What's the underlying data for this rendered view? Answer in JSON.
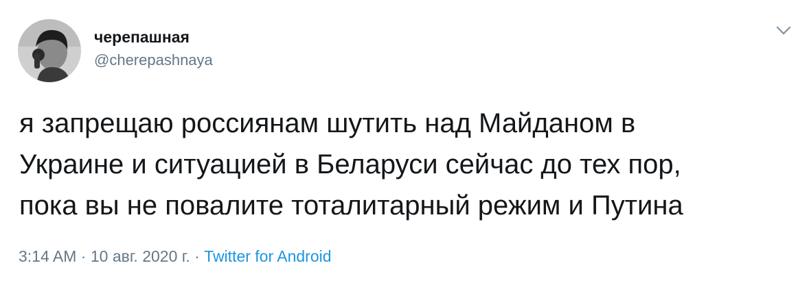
{
  "user": {
    "display_name": "черепашная",
    "handle": "@cherepashnaya"
  },
  "tweet": {
    "text": "я запрещаю россиянам шутить над Майданом в\nУкраине и ситуацией в Беларуси сейчас до тех пор,\nпока вы не повалите тоталитарный режим и Путина",
    "time": "3:14 AM",
    "separator": "·",
    "date": "10 авг. 2020 г.",
    "source": "Twitter for Android"
  },
  "icons": {
    "menu": "chevron-down-icon",
    "avatar": "avatar-photo"
  },
  "colors": {
    "text": "#14171a",
    "secondary": "#657786",
    "link": "#1b95e0"
  }
}
